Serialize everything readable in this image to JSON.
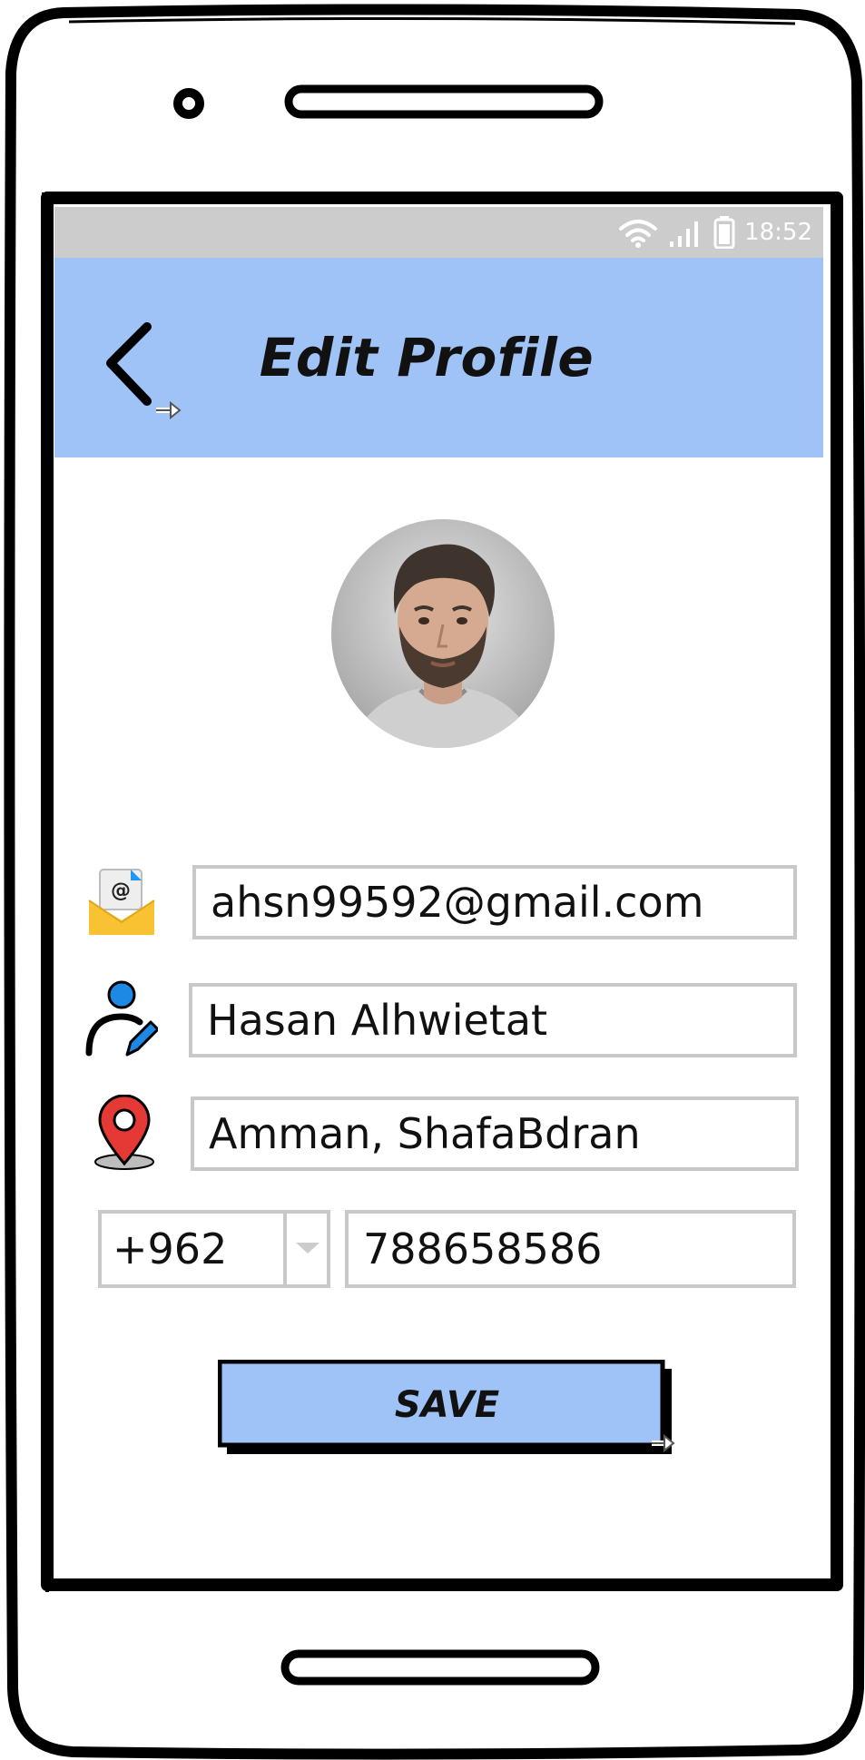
{
  "status_bar": {
    "time": "18:52"
  },
  "header": {
    "title": "Edit Profile"
  },
  "form": {
    "email": "ahsn99592@gmail.com",
    "name": "Hasan Alhwietat",
    "address": "Amman, ShafaBdran",
    "country_code": "+962",
    "phone": "788658586"
  },
  "actions": {
    "save_label": "SAVE"
  },
  "icons": {
    "back": "chevron-left-icon",
    "email": "envelope-icon",
    "name": "user-edit-icon",
    "address": "map-pin-icon",
    "dropdown": "caret-down-icon"
  },
  "colors": {
    "header_bg": "#9fc3f6",
    "status_bar_bg": "#cccccc",
    "field_border": "#c8c8c8",
    "button_bg": "#9fc3f6",
    "pin_red": "#e53935",
    "accent_blue": "#1e88e5",
    "envelope_yellow": "#f9c232"
  }
}
